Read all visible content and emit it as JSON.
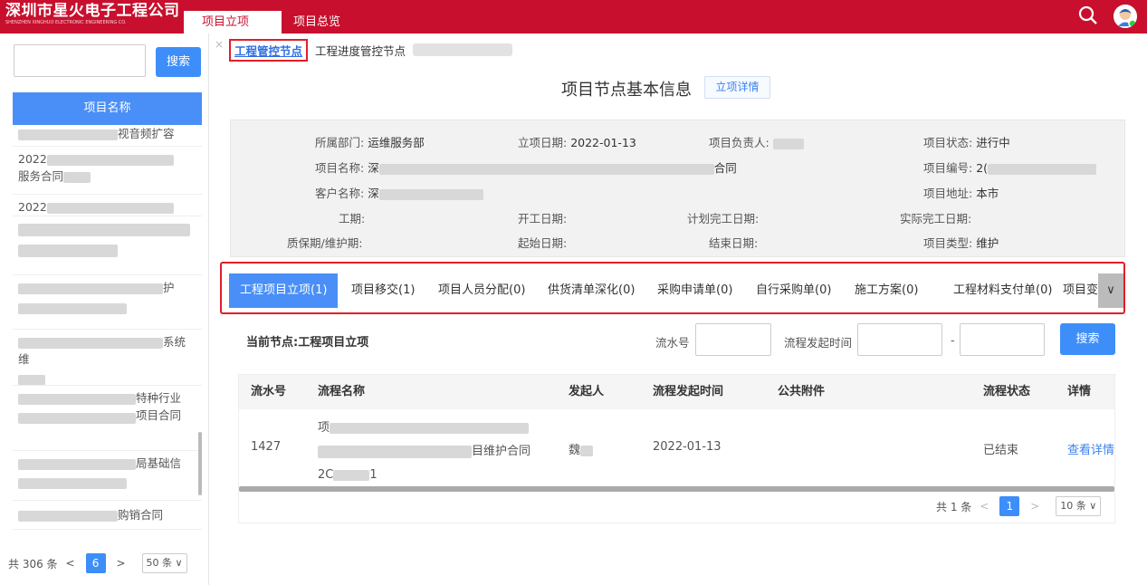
{
  "header": {
    "company_cn": "深圳市星火电子工程公司",
    "company_en": "SHENZHEN XINGHUO ELECTRONIC ENGINEERING CO.",
    "tabs": [
      {
        "label": "项目立项",
        "close": "×"
      },
      {
        "label": "项目总览"
      }
    ],
    "brand_color": "#c8102e"
  },
  "sidebar": {
    "search_placeholder": "",
    "search_label": "搜索",
    "list_header": "项目名称",
    "items": [
      {
        "text": "视音频扩容"
      },
      {
        "text": "2022",
        "text2": "服务合同"
      },
      {
        "text": "2022"
      },
      {
        "text": ""
      },
      {
        "text": "护"
      },
      {
        "text": "系统维"
      },
      {
        "text": "特种行业",
        "text2": "项目合同"
      },
      {
        "text": "局基础信"
      },
      {
        "text": "购销合同"
      }
    ],
    "pager": {
      "total": "共 306 条",
      "prev": "<",
      "current": "6",
      "next": ">",
      "size": "50 条 ∨"
    }
  },
  "main": {
    "subtabs": [
      {
        "label": "工程管控节点"
      },
      {
        "label": "工程进度管控节点"
      }
    ],
    "title": "项目节点基本信息",
    "detail_button": "立项详情",
    "info": {
      "dept_label": "所属部门:",
      "dept_value": "运维服务部",
      "date_label": "立项日期:",
      "date_value": "2022-01-13",
      "owner_label": "项目负责人:",
      "status_label": "项目状态:",
      "status_value": "进行中",
      "name_label": "项目名称:",
      "name_value": "深",
      "name_tail": "合同",
      "code_label": "项目编号:",
      "code_value": "2(",
      "customer_label": "客户名称:",
      "customer_value": "深",
      "address_label": "项目地址:",
      "address_value": "本市",
      "period_label": "工期:",
      "start_label": "开工日期:",
      "plan_end_label": "计划完工日期:",
      "actual_end_label": "实际完工日期:",
      "warranty_label": "质保期/维护期:",
      "begin_label": "起始日期:",
      "finish_label": "结束日期:",
      "type_label": "项目类型:",
      "type_value": "维护"
    },
    "nodes": [
      {
        "label": "工程项目立项(1)"
      },
      {
        "label": "项目移交(1)"
      },
      {
        "label": "项目人员分配(0)"
      },
      {
        "label": "供货清单深化(0)"
      },
      {
        "label": "采购申请单(0)"
      },
      {
        "label": "自行采购单(0)"
      },
      {
        "label": "施工方案(0)"
      },
      {
        "label": "工程材料支付单(0)"
      },
      {
        "label": "项目变"
      }
    ],
    "current_node": "当前节点:工程项目立项",
    "filter": {
      "serial_label": "流水号",
      "time_label": "流程发起时间",
      "dash": "-",
      "search_label": "搜索"
    },
    "table": {
      "headers": [
        "流水号",
        "流程名称",
        "发起人",
        "流程发起时间",
        "公共附件",
        "流程状态",
        "详情"
      ],
      "row": {
        "serial": "1427",
        "name_line1": "项",
        "name_line2": "目维护合同",
        "name_line3": "2C",
        "name_line3b": "1",
        "initiator": "魏",
        "time": "2022-01-13",
        "status": "已结束",
        "detail": "查看详情"
      },
      "pager": {
        "total": "共 1 条",
        "prev": "<",
        "current": "1",
        "next": ">",
        "size": "10 条 ∨"
      }
    }
  }
}
